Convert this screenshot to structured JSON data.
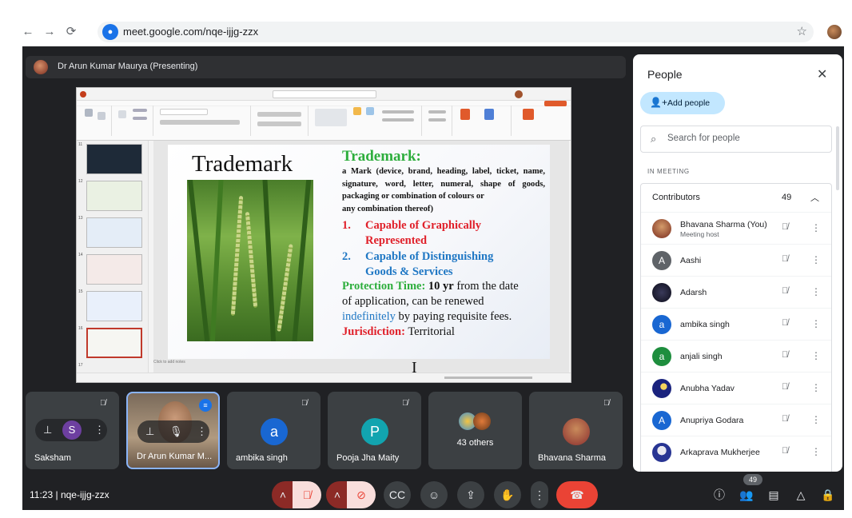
{
  "browser": {
    "url": "meet.google.com/nqe-ijjg-zzx",
    "back_icon": "←",
    "forward_icon": "→",
    "reload_icon": "⟳"
  },
  "meeting": {
    "presenter_banner": "Dr Arun Kumar Maurya (Presenting)",
    "clock": "11:23",
    "separator": "|",
    "code": "nqe-ijjg-zzx",
    "participant_count": "49"
  },
  "slide": {
    "heading": "Trademark",
    "title": "Trademark:",
    "definition": "a Mark (device, brand, heading, label, ticket, name, signature, word, letter, numeral, shape of goods, packaging or combination of colours or",
    "definition_cont": "any combination thereof)",
    "points": [
      {
        "num": "1.",
        "line1": "Capable of Graphically",
        "line2": "Represented"
      },
      {
        "num": "2.",
        "line1": "Capable of Distinguishing",
        "line2": "Goods & Services"
      }
    ],
    "protection_label": "Protection Time:",
    "protection_value": "10 yr",
    "protection_rest": "from the date",
    "application_line": "of application, can be renewed",
    "indefinitely": "indefinitely",
    "requisite": "by paying requisite fees.",
    "jurisdiction_label": "Jurisdiction:",
    "jurisdiction_value": "Territorial",
    "notes_placeholder": "Click to add notes"
  },
  "tiles": [
    {
      "name": "Saksham",
      "initial": "S",
      "color": "#6d3fa0"
    },
    {
      "name": "Dr Arun Kumar M...",
      "initial": "",
      "color": ""
    },
    {
      "name": "ambika singh",
      "initial": "a",
      "color": "#1967d2"
    },
    {
      "name": "Pooja Jha Maity",
      "initial": "P",
      "color": "#12a4af"
    },
    {
      "name": "43 others",
      "initial": "",
      "color": ""
    },
    {
      "name": "Bhavana Sharma",
      "initial": "",
      "color": ""
    }
  ],
  "people": {
    "title": "People",
    "add_label": "Add people",
    "search_placeholder": "Search for people",
    "section": "IN MEETING",
    "group_title": "Contributors",
    "group_count": "49",
    "list": [
      {
        "name": "Bhavana Sharma (You)",
        "sub": "Meeting host",
        "initial": "",
        "color": "#a0522d"
      },
      {
        "name": "Aashi",
        "sub": "",
        "initial": "A",
        "color": "#5f6368"
      },
      {
        "name": "Adarsh",
        "sub": "",
        "initial": "",
        "color": "#1a1a2e"
      },
      {
        "name": "ambika singh",
        "sub": "",
        "initial": "a",
        "color": "#1967d2"
      },
      {
        "name": "anjali singh",
        "sub": "",
        "initial": "a",
        "color": "#1e8e3e"
      },
      {
        "name": "Anubha Yadav",
        "sub": "",
        "initial": "",
        "color": "#1a237e"
      },
      {
        "name": "Anupriya Godara",
        "sub": "",
        "initial": "A",
        "color": "#1967d2"
      },
      {
        "name": "Arkaprava Mukherjee",
        "sub": "",
        "initial": "",
        "color": "#283593"
      }
    ]
  },
  "colors": {
    "meet_bg": "#202124",
    "accent_blue": "#8ab4f8",
    "end_call_red": "#ea4335",
    "add_people_bg": "#c2e7ff",
    "trademark_green": "#2eae3d",
    "slide_red": "#e0202a",
    "slide_blue": "#1f77c4"
  },
  "icons": {
    "mute": "mic-off-icon",
    "camera": "camera-off-icon",
    "captions": "captions-icon",
    "emoji": "emoji-icon",
    "present": "present-icon",
    "hand": "raise-hand-icon",
    "more": "more-vert-icon",
    "end": "end-call-icon"
  }
}
